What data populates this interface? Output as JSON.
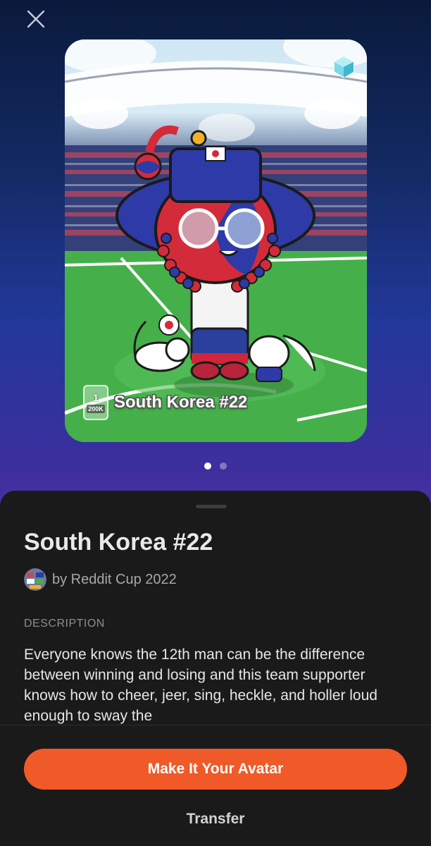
{
  "icons": {
    "close": "close-icon",
    "gem": "collectible-gem-icon"
  },
  "card": {
    "title": "South Korea #22",
    "edition_number": "1",
    "edition_total": "200K"
  },
  "pager": {
    "count": 2,
    "active_index": 0
  },
  "details": {
    "title": "South Korea #22",
    "creator": "by Reddit Cup 2022",
    "description_label": "DESCRIPTION",
    "description": "Everyone knows the 12th man can be the difference between winning and losing and this team supporter knows how to cheer, jeer, sing, heckle, and holler loud enough to sway the"
  },
  "actions": {
    "primary": "Make It Your Avatar",
    "secondary": "Transfer"
  },
  "colors": {
    "accent": "#f05a28",
    "sheet_background": "#1a1a1b"
  }
}
